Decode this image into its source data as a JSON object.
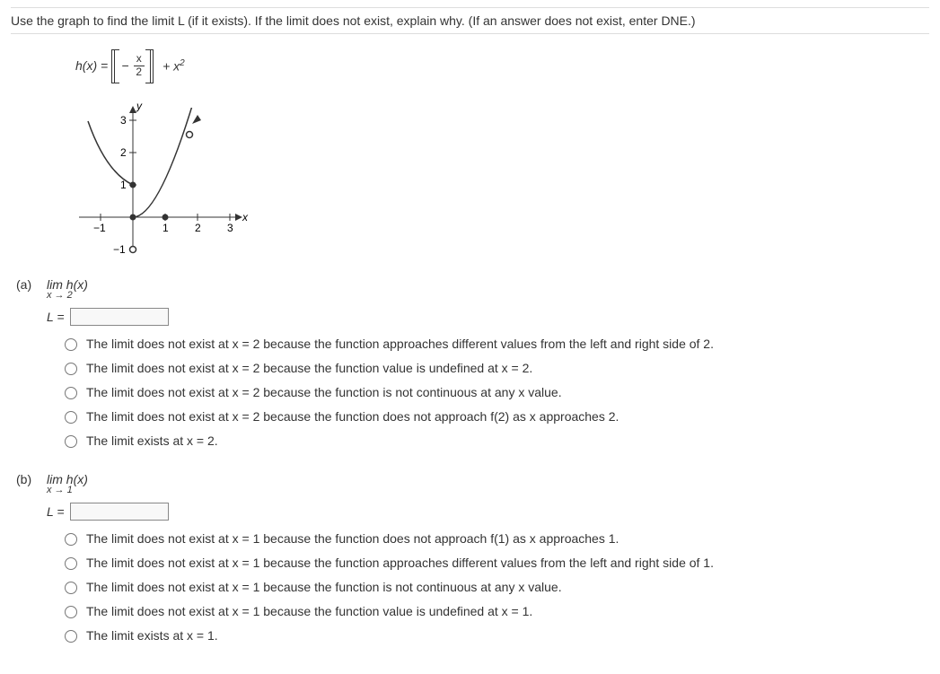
{
  "prompt": "Use the graph to find the limit L (if it exists). If the limit does not exist, explain why. (If an answer does not exist, enter DNE.)",
  "func": {
    "lhs": "h(x) = ",
    "neg": "−",
    "num": "x",
    "den": "2",
    "tail": " + x",
    "sup": "2"
  },
  "graph": {
    "ylabel": "y",
    "xlabel": "x",
    "yticks": [
      "3",
      "2",
      "1",
      "−1"
    ],
    "xticks": [
      "−1",
      "1",
      "2",
      "3"
    ]
  },
  "partA": {
    "label": "(a)",
    "limtop": "lim ",
    "limfn": "h(x)",
    "limsub": "x → 2",
    "Leq": "L = ",
    "value": "",
    "options": [
      "The limit does not exist at x = 2 because the function approaches different values from the left and right side of 2.",
      "The limit does not exist at x = 2 because the function value is undefined at x = 2.",
      "The limit does not exist at x = 2 because the function is not continuous at any x value.",
      "The limit does not exist at x = 2 because the function does not approach f(2) as x approaches 2.",
      "The limit exists at x = 2."
    ]
  },
  "partB": {
    "label": "(b)",
    "limtop": "lim ",
    "limfn": "h(x)",
    "limsub": "x → 1",
    "Leq": "L = ",
    "value": "",
    "options": [
      "The limit does not exist at x = 1 because the function does not approach f(1) as x approaches 1.",
      "The limit does not exist at x = 1 because the function approaches different values from the left and right side of 1.",
      "The limit does not exist at x = 1 because the function is not continuous at any x value.",
      "The limit does not exist at x = 1 because the function value is undefined at x = 1.",
      "The limit exists at x = 1."
    ]
  },
  "chart_data": {
    "type": "line",
    "title": "",
    "xlabel": "x",
    "ylabel": "y",
    "xlim": [
      -1.5,
      3.2
    ],
    "ylim": [
      -1.3,
      3.6
    ],
    "series": [
      {
        "name": "h segment 1 (x<0)",
        "x": [
          -1.4,
          -1.2,
          -1.0,
          -0.8,
          -0.6,
          -0.4,
          -0.2,
          0.0
        ],
        "y": [
          2.96,
          2.44,
          2.0,
          1.64,
          1.36,
          1.16,
          1.04,
          1.0
        ]
      },
      {
        "name": "h segment 2 (0≤x<2)",
        "x": [
          0.0,
          0.2,
          0.4,
          0.6,
          0.8,
          1.0,
          1.2,
          1.4,
          1.6,
          1.8,
          2.0
        ],
        "y": [
          0.0,
          0.04,
          0.16,
          0.36,
          0.64,
          1.0,
          1.44,
          1.96,
          2.56,
          3.24,
          4.0
        ]
      }
    ],
    "markers": [
      {
        "x": 0,
        "y": 1,
        "style": "closed"
      },
      {
        "x": 0,
        "y": 0,
        "style": "closed"
      },
      {
        "x": 1,
        "y": 0,
        "style": "closed"
      },
      {
        "x": 0,
        "y": -1,
        "style": "open"
      },
      {
        "x": 2,
        "y": 3,
        "style": "arrow-up"
      }
    ]
  }
}
